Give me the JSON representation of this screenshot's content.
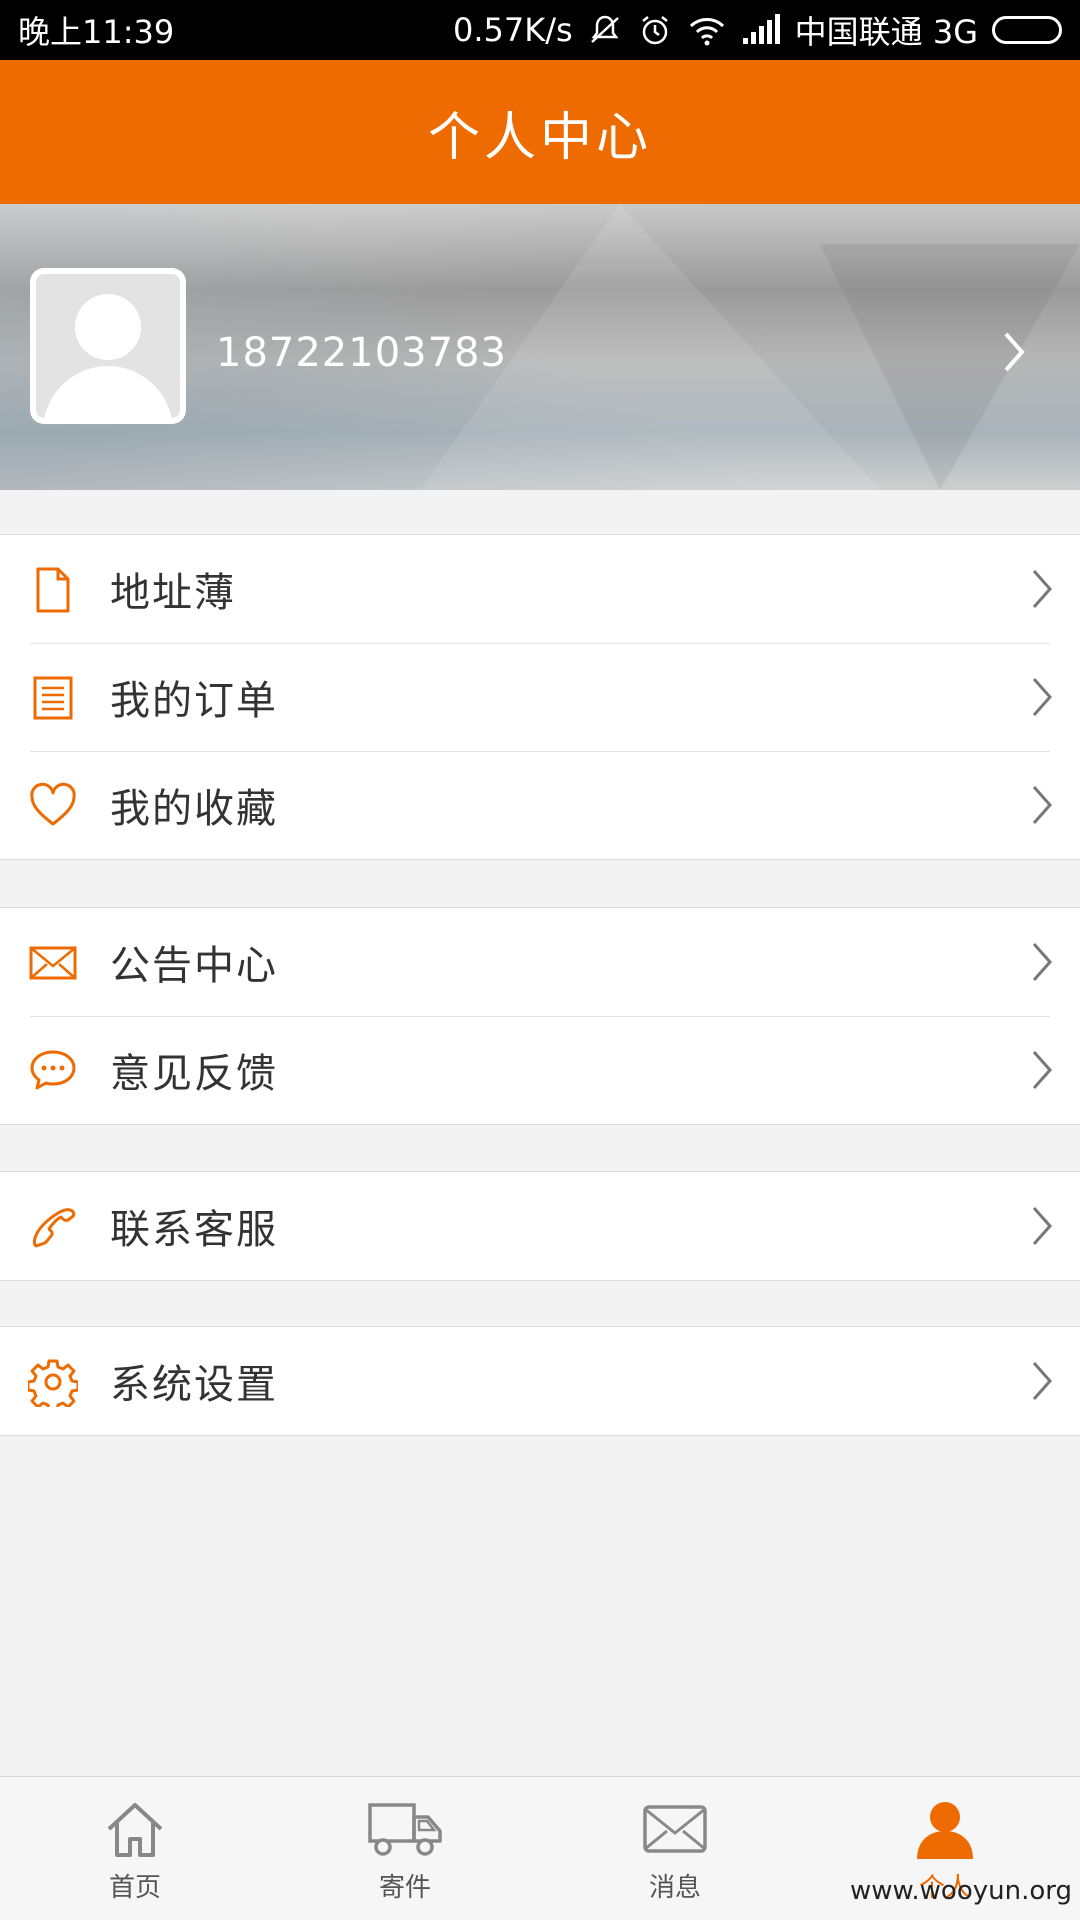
{
  "status_bar": {
    "time": "晚上11:39",
    "speed": "0.57K/s",
    "carrier": "中国联通 3G"
  },
  "header": {
    "title": "个人中心"
  },
  "profile": {
    "phone": "18722103783"
  },
  "menu": {
    "group1": [
      {
        "label": "地址薄",
        "icon": "document-icon"
      },
      {
        "label": "我的订单",
        "icon": "order-list-icon"
      },
      {
        "label": "我的收藏",
        "icon": "heart-icon"
      }
    ],
    "group2": [
      {
        "label": "公告中心",
        "icon": "envelope-icon"
      },
      {
        "label": "意见反馈",
        "icon": "chat-bubble-icon"
      }
    ],
    "group3": [
      {
        "label": "联系客服",
        "icon": "phone-icon"
      }
    ],
    "group4": [
      {
        "label": "系统设置",
        "icon": "gear-icon"
      }
    ]
  },
  "bottom_nav": {
    "items": [
      {
        "label": "首页",
        "icon": "home-icon"
      },
      {
        "label": "寄件",
        "icon": "truck-icon"
      },
      {
        "label": "消息",
        "icon": "envelope-icon"
      },
      {
        "label": "个人",
        "icon": "person-icon",
        "active": true
      }
    ]
  },
  "watermark": "www.wooyun.org",
  "colors": {
    "accent": "#ed6b00",
    "background": "#f3f3f3"
  }
}
